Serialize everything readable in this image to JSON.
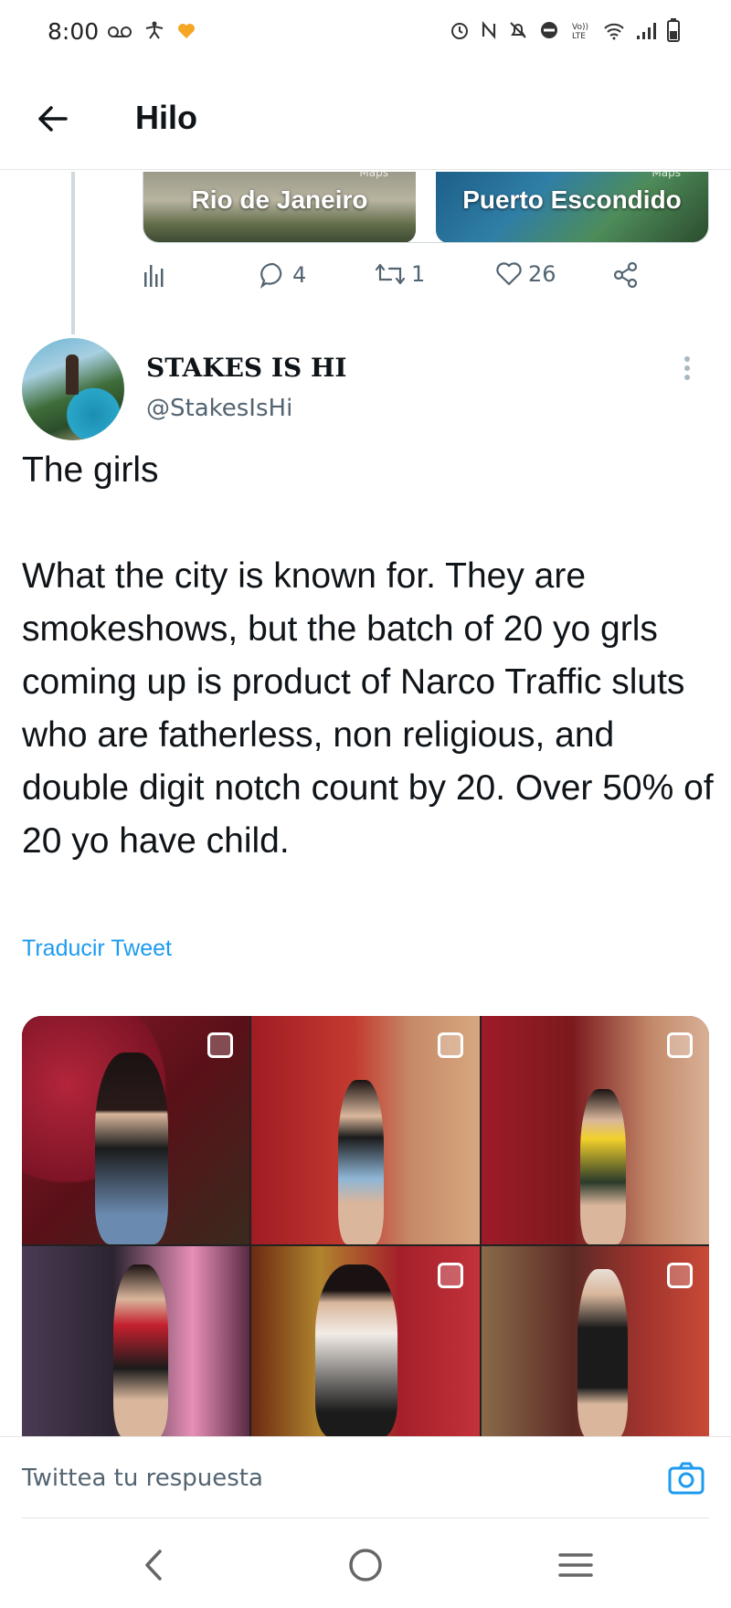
{
  "status_bar": {
    "time": "8:00",
    "left_icons": [
      "voicemail-icon",
      "accessibility-icon",
      "heart-app-icon"
    ],
    "right_icons": [
      "alarm-icon",
      "nfc-icon",
      "mute-icon",
      "dnd-icon",
      "volte-icon",
      "wifi-icon",
      "signal-icon",
      "battery-icon"
    ]
  },
  "header": {
    "title": "Hilo"
  },
  "previous_tweet": {
    "cards": [
      {
        "label": "Rio de Janeiro",
        "badge": "Maps"
      },
      {
        "label": "Puerto Escondido",
        "badge": "Maps"
      }
    ],
    "actions": {
      "replies": "4",
      "retweets": "1",
      "likes": "26"
    }
  },
  "tweet": {
    "display_name": "STAKES IS HI",
    "handle": "@StakesIsHi",
    "text": "The girls\n\nWhat the city is known for. They are smokeshows, but the batch of 20 yo grls coming up is product of Narco Traffic sluts who are fatherless, non religious, and double digit notch count by 20. Over 50% of 20 yo have child.",
    "translate_label": "Traducir Tweet",
    "photos": [
      "photo-1",
      "photo-2",
      "photo-3",
      "photo-4",
      "photo-5",
      "photo-6"
    ]
  },
  "reply": {
    "placeholder": "Twittea tu respuesta"
  },
  "colors": {
    "link": "#1d9bf0",
    "muted": "#536471",
    "text": "#0f1419"
  }
}
